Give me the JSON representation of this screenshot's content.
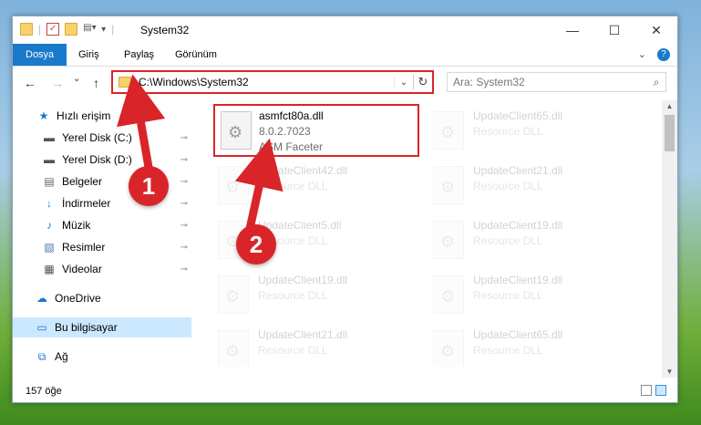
{
  "window": {
    "title": "System32",
    "controls": {
      "minimize": "—",
      "maximize": "☐",
      "close": "✕"
    }
  },
  "ribbon": {
    "tabs": [
      {
        "label": "Dosya",
        "active": true
      },
      {
        "label": "Giriş",
        "active": false
      },
      {
        "label": "Paylaş",
        "active": false
      },
      {
        "label": "Görünüm",
        "active": false
      }
    ],
    "expand_icon": "chevron-down-icon",
    "help_icon": "?"
  },
  "nav": {
    "back": "←",
    "forward": "→",
    "recent": "⌄",
    "up": "↑",
    "address": "C:\\Windows\\System32",
    "dropdown": "⌄",
    "refresh": "↻",
    "search_placeholder": "Ara: System32"
  },
  "sidebar": {
    "items": [
      {
        "label": "Hızlı erişim",
        "icon": "★",
        "pinned": false
      },
      {
        "label": "Yerel Disk (C:)",
        "icon": "▬",
        "pinned": true
      },
      {
        "label": "Yerel Disk (D:)",
        "icon": "▬",
        "pinned": true
      },
      {
        "label": "Belgeler",
        "icon": "▤",
        "pinned": true
      },
      {
        "label": "İndirmeler",
        "icon": "↓",
        "pinned": true
      },
      {
        "label": "Müzik",
        "icon": "♪",
        "pinned": true
      },
      {
        "label": "Resimler",
        "icon": "▧",
        "pinned": true
      },
      {
        "label": "Videolar",
        "icon": "▦",
        "pinned": true
      },
      {
        "label": "OneDrive",
        "icon": "☁",
        "pinned": false
      },
      {
        "label": "Bu bilgisayar",
        "icon": "▭",
        "pinned": false,
        "selected": true
      },
      {
        "label": "Ağ",
        "icon": "⧉",
        "pinned": false
      }
    ],
    "pin_glyph": "📌"
  },
  "files": [
    {
      "name": "asmfct80a.dll",
      "version": "8.0.2.7023",
      "description": "ASM Faceter",
      "highlighted": true
    },
    {
      "name": "UpdateClient65.dll",
      "version": "Resource DLL",
      "description": ""
    },
    {
      "name": "UpdateClient42.dll",
      "version": "Resource DLL",
      "description": ""
    },
    {
      "name": "UpdateClient21.dll",
      "version": "Resource DLL",
      "description": ""
    },
    {
      "name": "UpdateClient5.dll",
      "version": "Resource DLL",
      "description": ""
    },
    {
      "name": "UpdateClient19.dll",
      "version": "Resource DLL",
      "description": ""
    },
    {
      "name": "UpdateClient19.dll",
      "version": "Resource DLL",
      "description": ""
    },
    {
      "name": "UpdateClient19.dll",
      "version": "Resource DLL",
      "description": ""
    },
    {
      "name": "UpdateClient21.dll",
      "version": "Resource DLL",
      "description": ""
    },
    {
      "name": "UpdateClient65.dll",
      "version": "Resource DLL",
      "description": ""
    }
  ],
  "status": {
    "count": "157 öğe"
  },
  "callouts": [
    {
      "label": "1"
    },
    {
      "label": "2"
    }
  ],
  "colors": {
    "accent": "#1979ca",
    "highlight": "#d9252a",
    "selection": "#cce8ff"
  }
}
